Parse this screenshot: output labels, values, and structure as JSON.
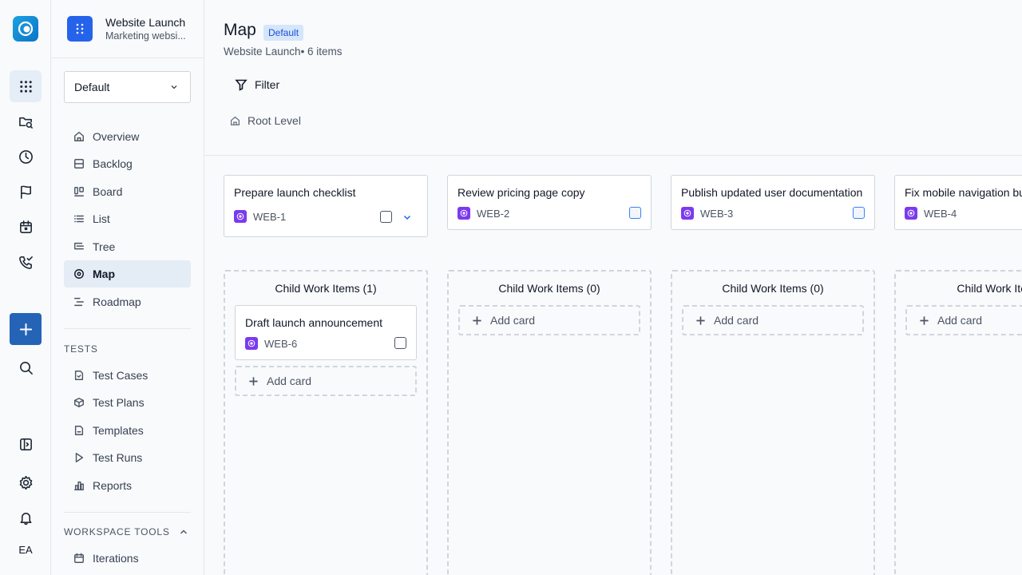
{
  "rail": {
    "initials": "EA",
    "icons": [
      "app-logo",
      "grid-icon",
      "folder-search-icon",
      "clock-icon",
      "flag-icon",
      "calendar-icon",
      "phone-check-icon",
      "plus-icon",
      "search-icon",
      "sidebar-toggle-icon",
      "gear-icon",
      "bell-icon"
    ]
  },
  "project": {
    "name": "Website Launch",
    "description": "Marketing websi..."
  },
  "view_select": {
    "value": "Default"
  },
  "nav": {
    "items": [
      {
        "label": "Overview",
        "icon": "home-icon"
      },
      {
        "label": "Backlog",
        "icon": "backlog-icon"
      },
      {
        "label": "Board",
        "icon": "board-icon"
      },
      {
        "label": "List",
        "icon": "list-icon"
      },
      {
        "label": "Tree",
        "icon": "tree-icon"
      },
      {
        "label": "Map",
        "icon": "map-pin-icon"
      },
      {
        "label": "Roadmap",
        "icon": "roadmap-icon"
      }
    ],
    "tests_label": "TESTS",
    "tests": [
      {
        "label": "Test Cases",
        "icon": "test-case-icon"
      },
      {
        "label": "Test Plans",
        "icon": "box-icon"
      },
      {
        "label": "Templates",
        "icon": "file-icon"
      },
      {
        "label": "Test Runs",
        "icon": "play-icon"
      },
      {
        "label": "Reports",
        "icon": "bar-chart-icon"
      }
    ],
    "workspace_label": "WORKSPACE TOOLS",
    "workspace": [
      {
        "label": "Iterations",
        "icon": "calendar-icon"
      }
    ]
  },
  "page": {
    "title": "Map",
    "badge": "Default",
    "subtitle": "Website Launch• 6 items",
    "filter_label": "Filter",
    "breadcrumb": "Root Level"
  },
  "cards": [
    {
      "title": "Prepare launch checklist",
      "id": "WEB-1"
    },
    {
      "title": "Review pricing page copy",
      "id": "WEB-2"
    },
    {
      "title": "Publish updated user documentation",
      "id": "WEB-3"
    },
    {
      "title": "Fix mobile navigation bu",
      "id": "WEB-4"
    }
  ],
  "columns": [
    {
      "title": "Child Work Items (1)",
      "children": [
        {
          "title": "Draft launch announcement",
          "id": "WEB-6"
        }
      ],
      "add_label": "Add card"
    },
    {
      "title": "Child Work Items (0)",
      "children": [],
      "add_label": "Add card"
    },
    {
      "title": "Child Work Items (0)",
      "children": [],
      "add_label": "Add card"
    },
    {
      "title": "Child Work Item",
      "children": [],
      "add_label": "Add card"
    }
  ],
  "colors": {
    "accent": "#2563eb",
    "active_nav": "#e4ecf5",
    "id_icon": "#7c3aed",
    "badge_bg": "#d5e6fb"
  }
}
